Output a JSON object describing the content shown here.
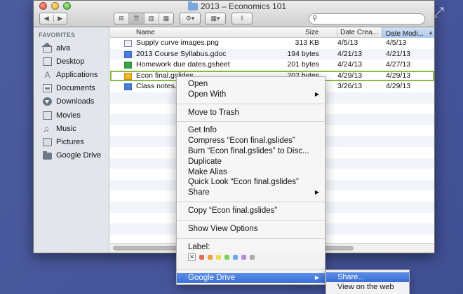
{
  "window": {
    "title": "2013 – Economics 101"
  },
  "toolbar": {
    "nav_back": "◀",
    "nav_forward": "▶",
    "views": [
      "⊞",
      "☰",
      "▥",
      "▦"
    ],
    "action_label": "⚙▾",
    "arrange_label": "▦▾",
    "share_label": "⇪"
  },
  "search": {
    "placeholder": ""
  },
  "sidebar": {
    "heading": "FAVORITES",
    "items": [
      {
        "label": "alva",
        "icon": "home-icon"
      },
      {
        "label": "Desktop",
        "icon": "desktop-icon"
      },
      {
        "label": "Applications",
        "icon": "applications-icon"
      },
      {
        "label": "Documents",
        "icon": "documents-icon"
      },
      {
        "label": "Downloads",
        "icon": "downloads-icon"
      },
      {
        "label": "Movies",
        "icon": "movies-icon"
      },
      {
        "label": "Music",
        "icon": "music-icon"
      },
      {
        "label": "Pictures",
        "icon": "pictures-icon"
      },
      {
        "label": "Google Drive",
        "icon": "google-drive-folder-icon"
      }
    ]
  },
  "columns": {
    "name": "Name",
    "size": "Size",
    "created": "Date Crea...",
    "modified": "Date Modi..."
  },
  "files": [
    {
      "name": "Supply curve images.png",
      "size": "313 KB",
      "created": "4/5/13",
      "modified": "4/5/13",
      "icon": "png-file-icon"
    },
    {
      "name": "2013 Course Syllabus.gdoc",
      "size": "194 bytes",
      "created": "4/21/13",
      "modified": "4/21/13",
      "icon": "gdoc-file-icon"
    },
    {
      "name": "Homework due dates.gsheet",
      "size": "201 bytes",
      "created": "4/24/13",
      "modified": "4/27/13",
      "icon": "gsheet-file-icon"
    },
    {
      "name": "Econ final.gslides",
      "size": "202 bytes",
      "created": "4/29/13",
      "modified": "4/29/13",
      "icon": "gslides-file-icon"
    },
    {
      "name": "Class notes.g",
      "size": "",
      "created": "3/26/13",
      "modified": "4/29/13",
      "icon": "gdoc-file-icon"
    }
  ],
  "context_menu": {
    "open": "Open",
    "open_with": "Open With",
    "move_to_trash": "Move to Trash",
    "get_info": "Get Info",
    "compress": "Compress “Econ final.gslides”",
    "burn": "Burn “Econ final.gslides” to Disc...",
    "duplicate": "Duplicate",
    "make_alias": "Make Alias",
    "quick_look": "Quick Look “Econ final.gslides”",
    "share": "Share",
    "copy": "Copy “Econ final.gslides”",
    "show_view_options": "Show View Options",
    "label": "Label:",
    "label_colors": [
      "#e96a5a",
      "#f0a040",
      "#eedb4c",
      "#7bcf5e",
      "#67a8e8",
      "#b48ad8",
      "#aaaaaa"
    ],
    "google_drive": "Google Drive"
  },
  "google_drive_submenu": {
    "share": "Share...",
    "view_on_web": "View on the web"
  },
  "expand_glyph": "⤢"
}
